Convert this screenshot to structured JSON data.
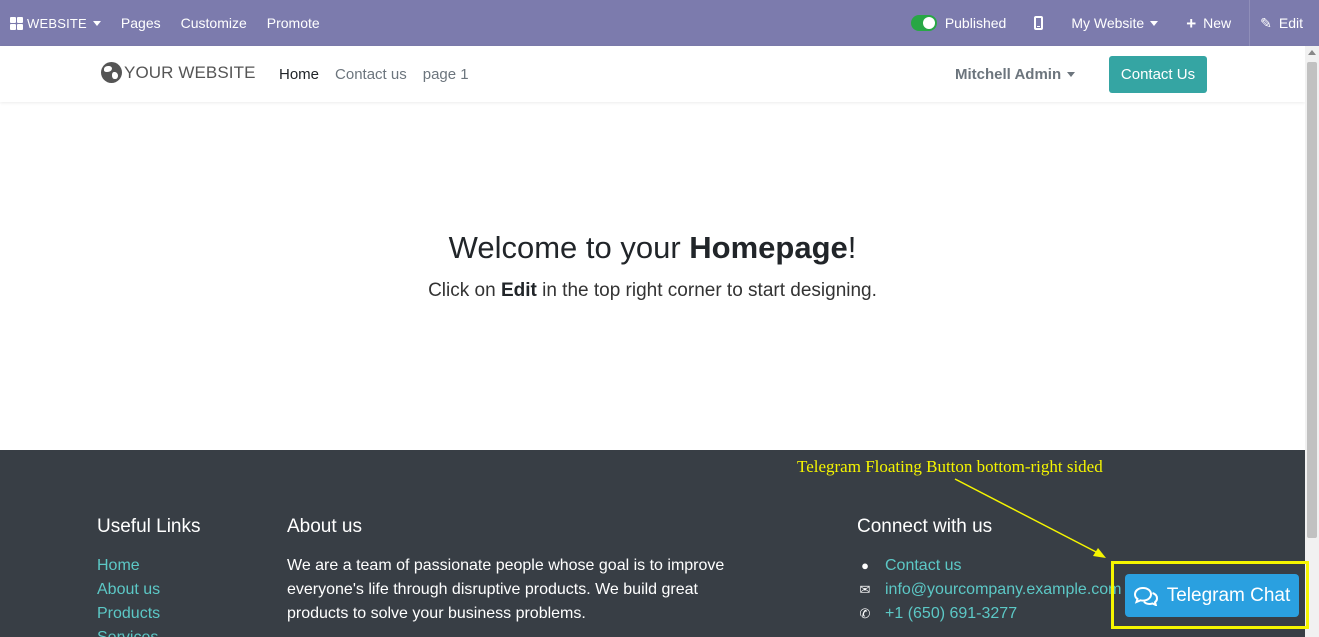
{
  "admin_bar": {
    "apps_label": "WEBSITE",
    "menu": [
      "Pages",
      "Customize",
      "Promote"
    ],
    "published_label": "Published",
    "website_label": "My Website",
    "new_label": "New",
    "edit_label": "Edit",
    "color": "#7c7bad"
  },
  "header": {
    "logo_text": "YOUR WEBSITE",
    "nav": [
      "Home",
      "Contact us",
      "page 1"
    ],
    "active_nav": "Home",
    "user_name": "Mitchell Admin",
    "cta_label": "Contact Us",
    "cta_color": "#35a5a3"
  },
  "hero": {
    "title_prefix": "Welcome to your ",
    "title_bold": "Homepage",
    "title_suffix": "!",
    "sub_prefix": "Click on ",
    "sub_bold": "Edit",
    "sub_suffix": " in the top right corner to start designing."
  },
  "footer": {
    "links_title": "Useful Links",
    "links": [
      "Home",
      "About us",
      "Products",
      "Services"
    ],
    "about_title": "About us",
    "about_text": "We are a team of passionate people whose goal is to improve everyone's life through disruptive products. We build great products to solve your business problems.",
    "connect_title": "Connect with us",
    "contact_label": "Contact us",
    "email": "info@yourcompany.example.com",
    "phone": "+1 (650) 691-3277"
  },
  "annotation": {
    "text": "Telegram Floating Button bottom-right sided",
    "color": "#f5f500"
  },
  "telegram": {
    "label": "Telegram Chat",
    "color": "#2aa0e0"
  }
}
